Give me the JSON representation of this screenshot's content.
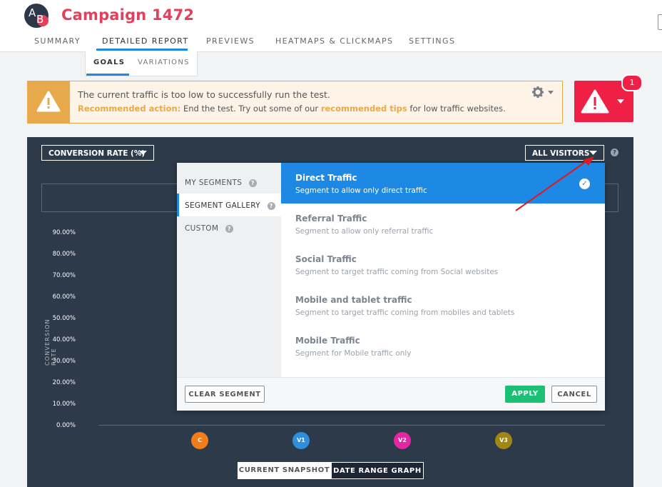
{
  "app": {
    "title": "Campaign 1472",
    "logo_a": "A",
    "logo_b": "B"
  },
  "tabs": [
    "SUMMARY",
    "DETAILED REPORT",
    "PREVIEWS",
    "HEATMAPS & CLICKMAPS",
    "SETTINGS"
  ],
  "active_tab": "DETAILED REPORT",
  "subtabs": [
    "GOALS",
    "VARIATIONS"
  ],
  "active_subtab": "GOALS",
  "alert": {
    "message": "The current traffic is too low to successfully run the test.",
    "action_label": "Recommended action:",
    "action_text_1": " End the test. Try out some of our ",
    "action_link": "recommended tips",
    "action_text_2": " for low traffic websites.",
    "notification_count": "1"
  },
  "panel": {
    "metric_select": "CONVERSION RATE (%)",
    "segment_select": "ALL VISITORS",
    "help_glyph": "?",
    "y_axis_label": "CONVERSION RATE",
    "y_ticks": [
      "90.00%",
      "80.00%",
      "70.00%",
      "60.00%",
      "50.00%",
      "40.00%",
      "30.00%",
      "20.00%",
      "10.00%",
      "0.00%"
    ],
    "variations": [
      {
        "label": "C",
        "color": "#f07c1a"
      },
      {
        "label": "V1",
        "color": "#2f8fdd"
      },
      {
        "label": "V2",
        "color": "#e426a3"
      },
      {
        "label": "V3",
        "color": "#a08612"
      }
    ],
    "view_toggle": [
      "CURRENT SNAPSHOT",
      "DATE RANGE GRAPH"
    ],
    "active_view": "DATE RANGE GRAPH"
  },
  "segments_dropdown": {
    "categories": [
      "MY SEGMENTS",
      "SEGMENT GALLERY",
      "CUSTOM"
    ],
    "active_category": "SEGMENT GALLERY",
    "options": [
      {
        "title": "Direct Traffic",
        "subtitle": "Segment to allow only direct traffic",
        "selected": true
      },
      {
        "title": "Referral Traffic",
        "subtitle": "Segment to allow only referral traffic",
        "selected": false
      },
      {
        "title": "Social Traffic",
        "subtitle": "Segment to target traffic coming from Social websites",
        "selected": false
      },
      {
        "title": "Mobile and tablet traffic",
        "subtitle": "Segment to target traffic coming from mobiles and tablets",
        "selected": false
      },
      {
        "title": "Mobile Traffic",
        "subtitle": "Segment for Mobile traffic only",
        "selected": false
      }
    ],
    "clear_label": "CLEAR SEGMENT",
    "apply_label": "APPLY",
    "cancel_label": "CANCEL"
  },
  "colors": {
    "brand": "#e2415c",
    "accent": "#1e88e5",
    "warning": "#e8a94a",
    "danger": "#ef1f46",
    "apply": "#1cbf73",
    "annotation_arrow": "#e0191f"
  },
  "icons": [
    "warning-icon",
    "gear-icon",
    "chevron-down-icon",
    "help-icon",
    "check-icon",
    "annotation-arrow"
  ]
}
